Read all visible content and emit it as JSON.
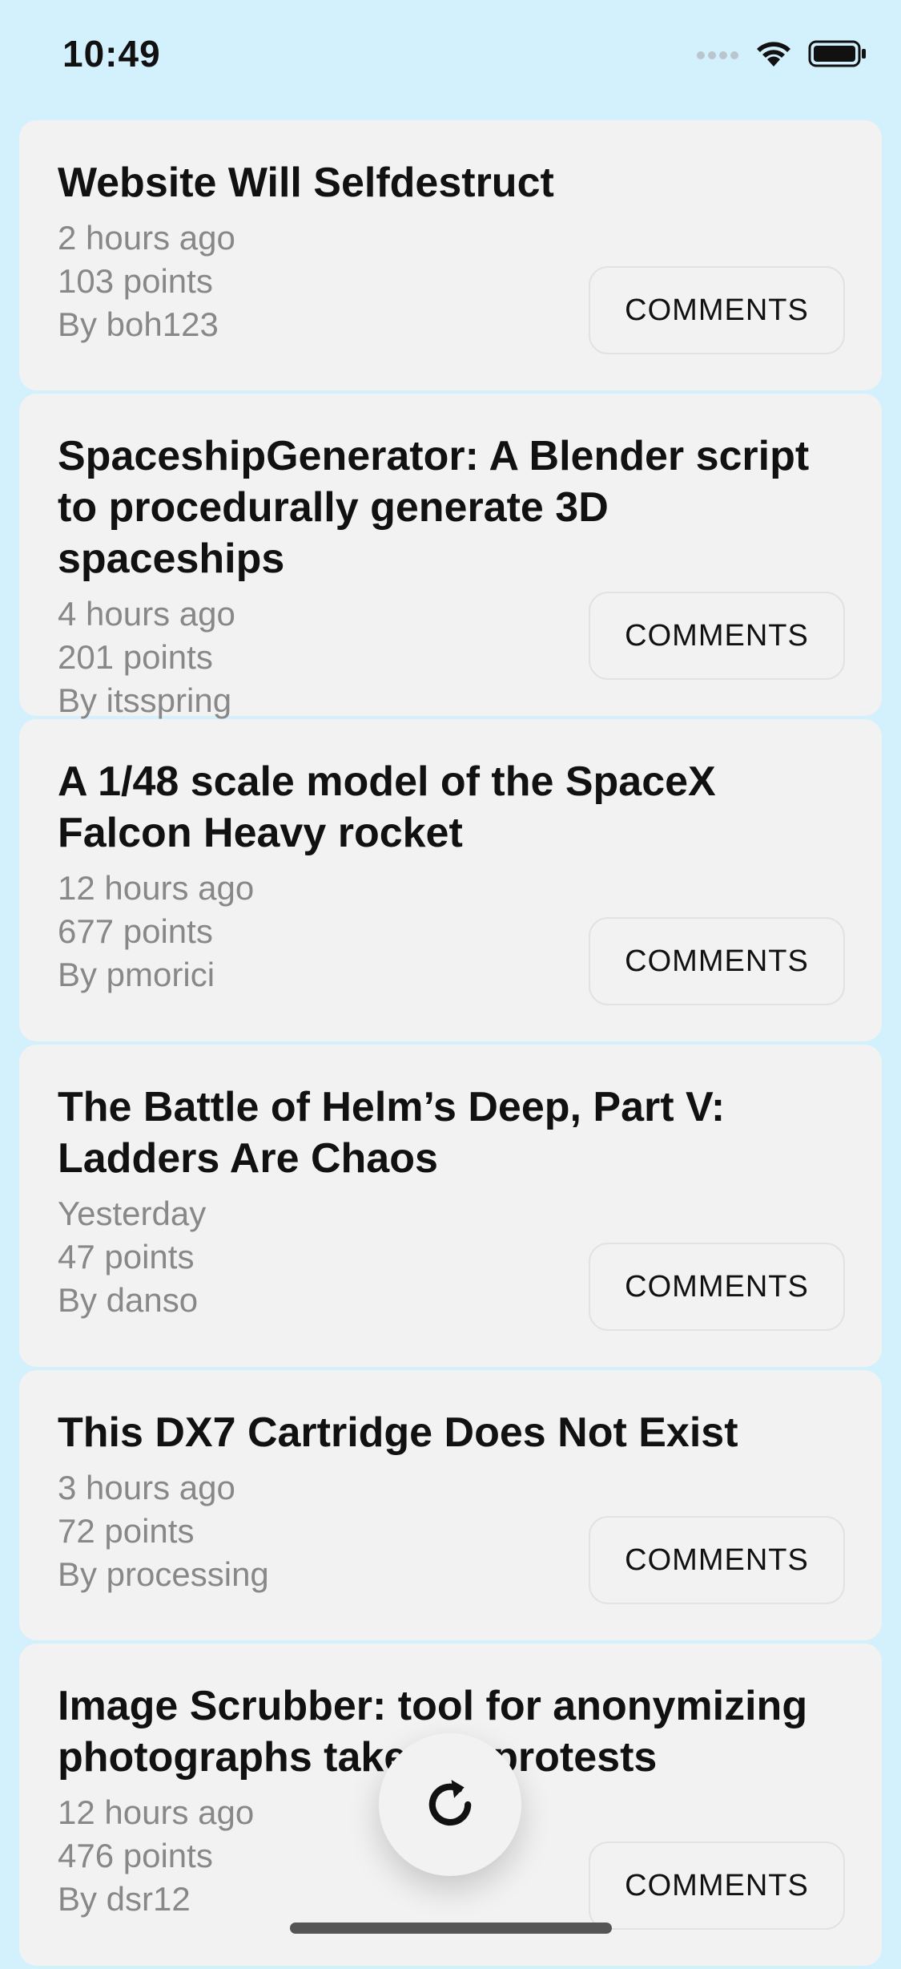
{
  "status_bar": {
    "time": "10:49"
  },
  "stories": [
    {
      "title": "Website Will Selfdestruct",
      "time": "2 hours ago",
      "points": "103 points",
      "author": "By boh123",
      "comments_label": "COMMENTS"
    },
    {
      "title": "SpaceshipGenerator: A Blender script to procedurally generate 3D spaceships",
      "time": "4 hours ago",
      "points": "201 points",
      "author": "By itsspring",
      "comments_label": "COMMENTS"
    },
    {
      "title": "A 1/48 scale model of the SpaceX Falcon Heavy rocket",
      "time": "12 hours ago",
      "points": "677 points",
      "author": "By pmorici",
      "comments_label": "COMMENTS"
    },
    {
      "title": "The Battle of Helm’s Deep, Part V: Ladders Are Chaos",
      "time": "Yesterday",
      "points": "47 points",
      "author": "By danso",
      "comments_label": "COMMENTS"
    },
    {
      "title": "This DX7 Cartridge Does Not Exist",
      "time": "3 hours ago",
      "points": "72 points",
      "author": "By processing",
      "comments_label": "COMMENTS"
    },
    {
      "title": "Image Scrubber: tool for anonymizing photographs taken at protests",
      "time": "12 hours ago",
      "points": "476 points",
      "author": "By dsr12",
      "comments_label": "COMMENTS"
    }
  ],
  "icons": {
    "refresh": "refresh-icon",
    "signal": "signal-icon",
    "wifi": "wifi-icon",
    "battery": "battery-icon"
  },
  "colors": {
    "background": "#d3f0fd",
    "card": "#f2f2f2",
    "meta_text": "#888888"
  }
}
